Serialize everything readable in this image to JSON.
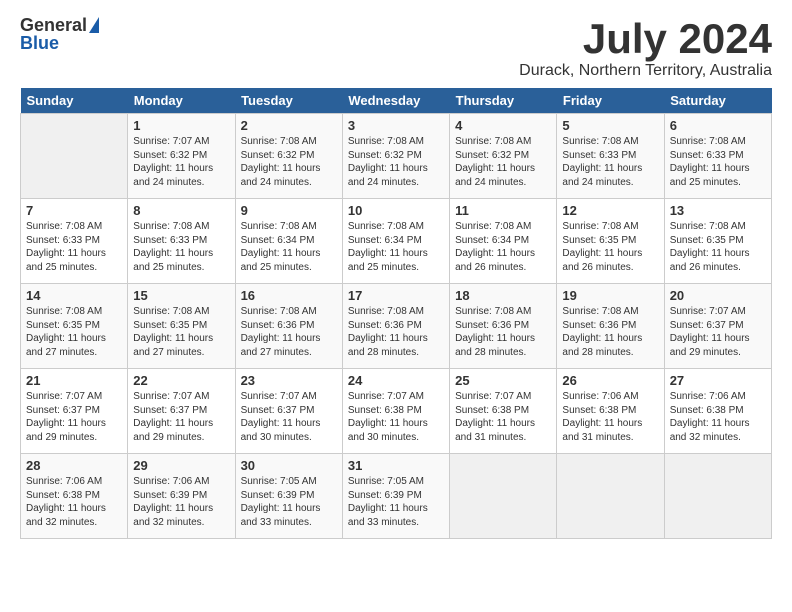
{
  "header": {
    "logo_general": "General",
    "logo_blue": "Blue",
    "month_title": "July 2024",
    "location": "Durack, Northern Territory, Australia"
  },
  "calendar": {
    "days_of_week": [
      "Sunday",
      "Monday",
      "Tuesday",
      "Wednesday",
      "Thursday",
      "Friday",
      "Saturday"
    ],
    "weeks": [
      [
        {
          "day": "",
          "info": ""
        },
        {
          "day": "1",
          "info": "Sunrise: 7:07 AM\nSunset: 6:32 PM\nDaylight: 11 hours\nand 24 minutes."
        },
        {
          "day": "2",
          "info": "Sunrise: 7:08 AM\nSunset: 6:32 PM\nDaylight: 11 hours\nand 24 minutes."
        },
        {
          "day": "3",
          "info": "Sunrise: 7:08 AM\nSunset: 6:32 PM\nDaylight: 11 hours\nand 24 minutes."
        },
        {
          "day": "4",
          "info": "Sunrise: 7:08 AM\nSunset: 6:32 PM\nDaylight: 11 hours\nand 24 minutes."
        },
        {
          "day": "5",
          "info": "Sunrise: 7:08 AM\nSunset: 6:33 PM\nDaylight: 11 hours\nand 24 minutes."
        },
        {
          "day": "6",
          "info": "Sunrise: 7:08 AM\nSunset: 6:33 PM\nDaylight: 11 hours\nand 25 minutes."
        }
      ],
      [
        {
          "day": "7",
          "info": "Sunrise: 7:08 AM\nSunset: 6:33 PM\nDaylight: 11 hours\nand 25 minutes."
        },
        {
          "day": "8",
          "info": "Sunrise: 7:08 AM\nSunset: 6:33 PM\nDaylight: 11 hours\nand 25 minutes."
        },
        {
          "day": "9",
          "info": "Sunrise: 7:08 AM\nSunset: 6:34 PM\nDaylight: 11 hours\nand 25 minutes."
        },
        {
          "day": "10",
          "info": "Sunrise: 7:08 AM\nSunset: 6:34 PM\nDaylight: 11 hours\nand 25 minutes."
        },
        {
          "day": "11",
          "info": "Sunrise: 7:08 AM\nSunset: 6:34 PM\nDaylight: 11 hours\nand 26 minutes."
        },
        {
          "day": "12",
          "info": "Sunrise: 7:08 AM\nSunset: 6:35 PM\nDaylight: 11 hours\nand 26 minutes."
        },
        {
          "day": "13",
          "info": "Sunrise: 7:08 AM\nSunset: 6:35 PM\nDaylight: 11 hours\nand 26 minutes."
        }
      ],
      [
        {
          "day": "14",
          "info": "Sunrise: 7:08 AM\nSunset: 6:35 PM\nDaylight: 11 hours\nand 27 minutes."
        },
        {
          "day": "15",
          "info": "Sunrise: 7:08 AM\nSunset: 6:35 PM\nDaylight: 11 hours\nand 27 minutes."
        },
        {
          "day": "16",
          "info": "Sunrise: 7:08 AM\nSunset: 6:36 PM\nDaylight: 11 hours\nand 27 minutes."
        },
        {
          "day": "17",
          "info": "Sunrise: 7:08 AM\nSunset: 6:36 PM\nDaylight: 11 hours\nand 28 minutes."
        },
        {
          "day": "18",
          "info": "Sunrise: 7:08 AM\nSunset: 6:36 PM\nDaylight: 11 hours\nand 28 minutes."
        },
        {
          "day": "19",
          "info": "Sunrise: 7:08 AM\nSunset: 6:36 PM\nDaylight: 11 hours\nand 28 minutes."
        },
        {
          "day": "20",
          "info": "Sunrise: 7:07 AM\nSunset: 6:37 PM\nDaylight: 11 hours\nand 29 minutes."
        }
      ],
      [
        {
          "day": "21",
          "info": "Sunrise: 7:07 AM\nSunset: 6:37 PM\nDaylight: 11 hours\nand 29 minutes."
        },
        {
          "day": "22",
          "info": "Sunrise: 7:07 AM\nSunset: 6:37 PM\nDaylight: 11 hours\nand 29 minutes."
        },
        {
          "day": "23",
          "info": "Sunrise: 7:07 AM\nSunset: 6:37 PM\nDaylight: 11 hours\nand 30 minutes."
        },
        {
          "day": "24",
          "info": "Sunrise: 7:07 AM\nSunset: 6:38 PM\nDaylight: 11 hours\nand 30 minutes."
        },
        {
          "day": "25",
          "info": "Sunrise: 7:07 AM\nSunset: 6:38 PM\nDaylight: 11 hours\nand 31 minutes."
        },
        {
          "day": "26",
          "info": "Sunrise: 7:06 AM\nSunset: 6:38 PM\nDaylight: 11 hours\nand 31 minutes."
        },
        {
          "day": "27",
          "info": "Sunrise: 7:06 AM\nSunset: 6:38 PM\nDaylight: 11 hours\nand 32 minutes."
        }
      ],
      [
        {
          "day": "28",
          "info": "Sunrise: 7:06 AM\nSunset: 6:38 PM\nDaylight: 11 hours\nand 32 minutes."
        },
        {
          "day": "29",
          "info": "Sunrise: 7:06 AM\nSunset: 6:39 PM\nDaylight: 11 hours\nand 32 minutes."
        },
        {
          "day": "30",
          "info": "Sunrise: 7:05 AM\nSunset: 6:39 PM\nDaylight: 11 hours\nand 33 minutes."
        },
        {
          "day": "31",
          "info": "Sunrise: 7:05 AM\nSunset: 6:39 PM\nDaylight: 11 hours\nand 33 minutes."
        },
        {
          "day": "",
          "info": ""
        },
        {
          "day": "",
          "info": ""
        },
        {
          "day": "",
          "info": ""
        }
      ]
    ]
  }
}
